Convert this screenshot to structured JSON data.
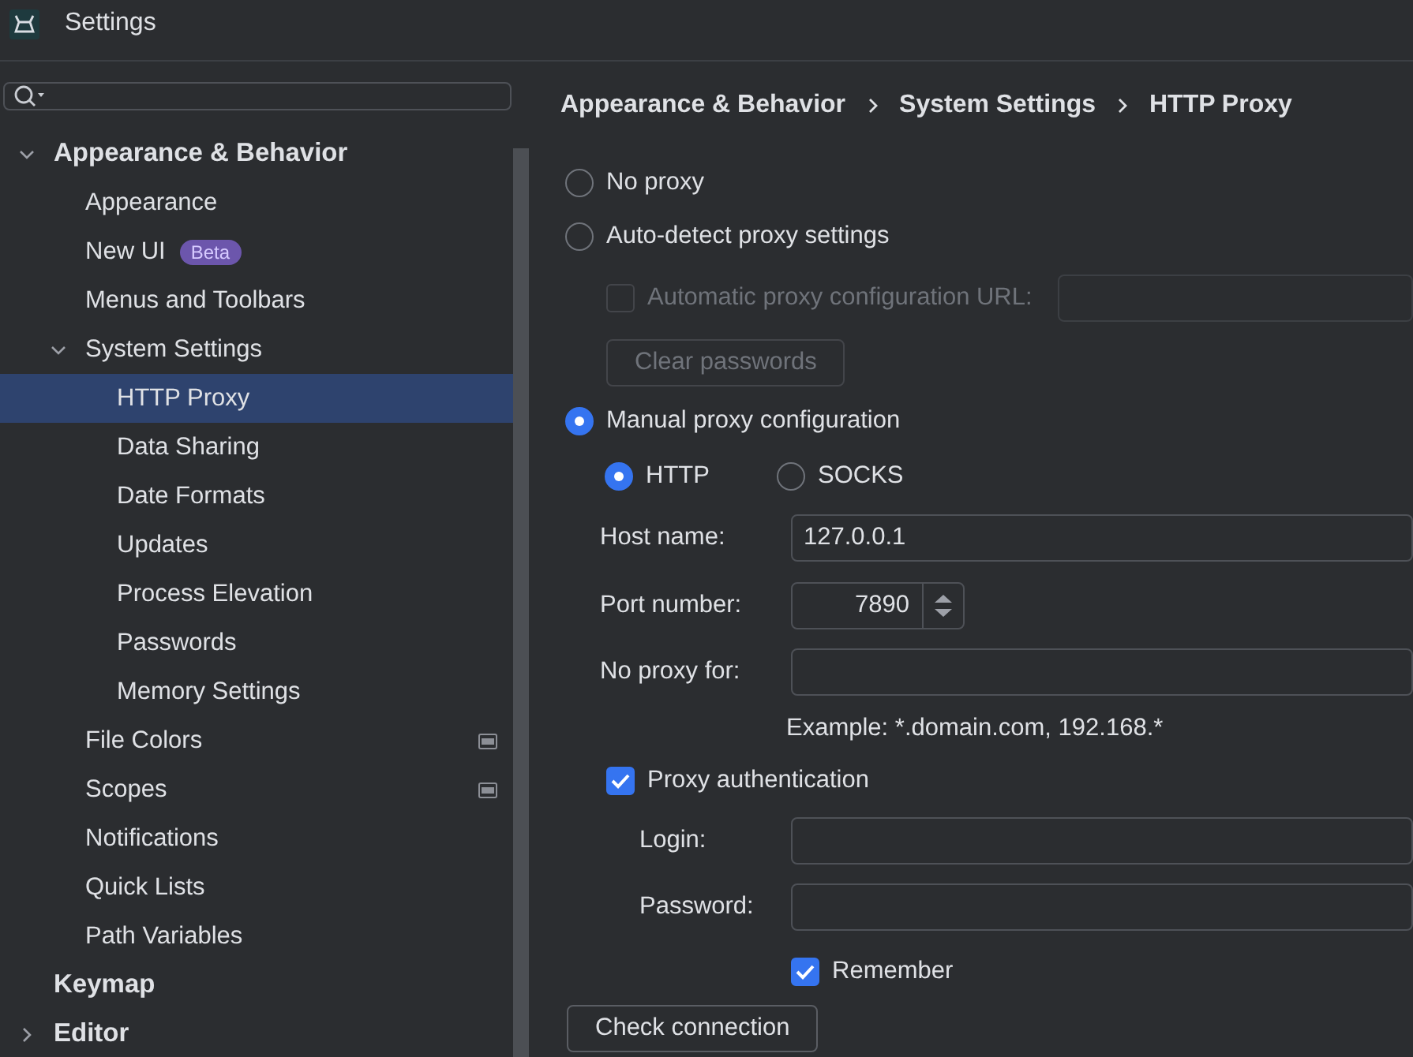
{
  "window": {
    "title": "Settings"
  },
  "tree": [
    {
      "label": "Appearance & Behavior",
      "expanded": true,
      "selected": false,
      "children": [
        {
          "label": "Appearance",
          "selected": false
        },
        {
          "label": "New UI",
          "badge": "Beta",
          "selected": false
        },
        {
          "label": "Menus and Toolbars",
          "selected": false
        },
        {
          "label": "System Settings",
          "expanded": true,
          "selected": false,
          "children": [
            {
              "label": "HTTP Proxy",
              "selected": true
            },
            {
              "label": "Data Sharing",
              "selected": false
            },
            {
              "label": "Date Formats",
              "selected": false
            },
            {
              "label": "Updates",
              "selected": false
            },
            {
              "label": "Process Elevation",
              "selected": false
            },
            {
              "label": "Passwords",
              "selected": false
            },
            {
              "label": "Memory Settings",
              "selected": false
            }
          ]
        },
        {
          "label": "File Colors",
          "project_level": true,
          "selected": false
        },
        {
          "label": "Scopes",
          "project_level": true,
          "selected": false
        },
        {
          "label": "Notifications",
          "selected": false
        },
        {
          "label": "Quick Lists",
          "selected": false
        },
        {
          "label": "Path Variables",
          "selected": false
        }
      ]
    },
    {
      "label": "Keymap",
      "selected": false
    },
    {
      "label": "Editor",
      "expanded": false,
      "selected": false
    }
  ],
  "breadcrumb": [
    "Appearance & Behavior",
    "System Settings",
    "HTTP Proxy"
  ],
  "proxy_modes": [
    {
      "label": "No proxy",
      "selected": false
    },
    {
      "label": "Auto-detect proxy settings",
      "selected": false
    },
    {
      "label": "Manual proxy configuration",
      "selected": true
    }
  ],
  "auto_config": {
    "label": "Automatic proxy configuration URL:",
    "checked": false,
    "disabled": true
  },
  "clear_passwords": {
    "label": "Clear passwords",
    "disabled": true
  },
  "protocols": [
    {
      "label": "HTTP",
      "selected": true
    },
    {
      "label": "SOCKS",
      "selected": false
    }
  ],
  "host": {
    "label": "Host name:",
    "value": "127.0.0.1"
  },
  "port": {
    "label": "Port number:",
    "value": "7890"
  },
  "no_proxy_for": {
    "label": "No proxy for:"
  },
  "example": "Example: *.domain.com, 192.168.*",
  "proxy_auth": {
    "label": "Proxy authentication",
    "checked": true
  },
  "login": {
    "label": "Login:"
  },
  "password": {
    "label": "Password:"
  },
  "remember": {
    "label": "Remember",
    "checked": true
  },
  "check_button": "Check connection"
}
